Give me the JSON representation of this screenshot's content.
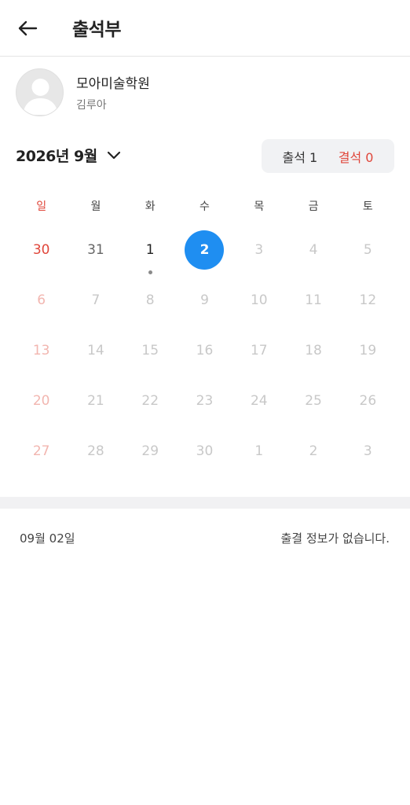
{
  "header": {
    "title": "출석부",
    "back_icon": "arrow-left-icon"
  },
  "profile": {
    "academy": "모아미술학원",
    "student": "김루아",
    "avatar_icon": "default-avatar-icon"
  },
  "month": {
    "label": "2026년 9월",
    "chevron_icon": "chevron-down-icon"
  },
  "summary": {
    "present": "출석 1",
    "absent": "결석 0"
  },
  "weekdays": [
    "일",
    "월",
    "화",
    "수",
    "목",
    "금",
    "토"
  ],
  "days": [
    {
      "n": "30",
      "state": "active"
    },
    {
      "n": "31",
      "state": "active"
    },
    {
      "n": "1",
      "state": "today",
      "dot": true
    },
    {
      "n": "2",
      "state": "selected"
    },
    {
      "n": "3",
      "state": "muted"
    },
    {
      "n": "4",
      "state": "muted"
    },
    {
      "n": "5",
      "state": "muted"
    },
    {
      "n": "6",
      "state": "muted"
    },
    {
      "n": "7",
      "state": "muted"
    },
    {
      "n": "8",
      "state": "muted"
    },
    {
      "n": "9",
      "state": "muted"
    },
    {
      "n": "10",
      "state": "muted"
    },
    {
      "n": "11",
      "state": "muted"
    },
    {
      "n": "12",
      "state": "muted"
    },
    {
      "n": "13",
      "state": "muted"
    },
    {
      "n": "14",
      "state": "muted"
    },
    {
      "n": "15",
      "state": "muted"
    },
    {
      "n": "16",
      "state": "muted"
    },
    {
      "n": "17",
      "state": "muted"
    },
    {
      "n": "18",
      "state": "muted"
    },
    {
      "n": "19",
      "state": "muted"
    },
    {
      "n": "20",
      "state": "muted"
    },
    {
      "n": "21",
      "state": "muted"
    },
    {
      "n": "22",
      "state": "muted"
    },
    {
      "n": "23",
      "state": "muted"
    },
    {
      "n": "24",
      "state": "muted"
    },
    {
      "n": "25",
      "state": "muted"
    },
    {
      "n": "26",
      "state": "muted"
    },
    {
      "n": "27",
      "state": "muted"
    },
    {
      "n": "28",
      "state": "muted"
    },
    {
      "n": "29",
      "state": "muted"
    },
    {
      "n": "30",
      "state": "muted"
    },
    {
      "n": "1",
      "state": "muted"
    },
    {
      "n": "2",
      "state": "muted"
    },
    {
      "n": "3",
      "state": "muted"
    }
  ],
  "detail": {
    "date": "09월 02일",
    "message": "출결 정보가 없습니다."
  },
  "colors": {
    "accent": "#1f8ef1",
    "sunday": "#e0463a",
    "absent": "#e0463a"
  }
}
